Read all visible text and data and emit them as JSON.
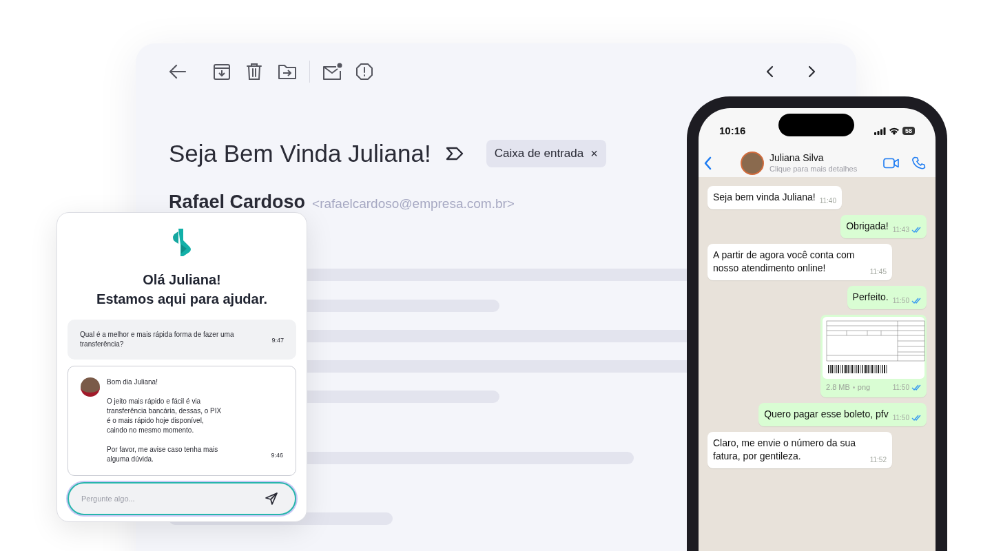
{
  "email": {
    "subject": "Seja Bem Vinda Juliana!",
    "label_chip": {
      "label": "Caixa de entrada",
      "close": "×"
    },
    "sender": {
      "name": "Rafael Cardoso",
      "email": "<rafaelcardoso@empresa.com.br>"
    }
  },
  "chat_widget": {
    "heading": [
      "Olá Juliana!",
      "Estamos aqui para ajudar."
    ],
    "messages": [
      {
        "kind": "user",
        "paragraphs": [
          "Qual é a melhor e mais rápida forma de fazer uma transferência?"
        ],
        "time": "9:47"
      },
      {
        "kind": "agent",
        "paragraphs": [
          "Bom dia Juliana!",
          "O jeito mais rápido e fácil é via transferência bancária, dessas, o PIX é o mais rápido hoje disponível, caindo no mesmo momento.",
          "Por favor, me avise caso tenha mais alguma dúvida."
        ],
        "time": "9:46"
      }
    ],
    "input": {
      "placeholder": "Pergunte algo..."
    }
  },
  "phone": {
    "status_bar": {
      "time": "10:16",
      "battery": "58"
    },
    "contact": {
      "name": "Juliana Silva",
      "subtitle": "Clique para mais detalhes"
    },
    "messages": [
      {
        "outgoing": false,
        "kind": "text",
        "text": "Seja bem vinda Juliana!",
        "time": "11:40"
      },
      {
        "outgoing": true,
        "kind": "text",
        "text": "Obrigada!",
        "time": "11:43",
        "read": true
      },
      {
        "outgoing": false,
        "kind": "text",
        "text": "A partir de agora você conta com nosso atendimento online!",
        "time": "11:45"
      },
      {
        "outgoing": true,
        "kind": "text",
        "text": "Perfeito.",
        "time": "11:50",
        "read": true
      },
      {
        "outgoing": true,
        "kind": "image",
        "size": "2.8 MB",
        "format": "png",
        "time": "11:50",
        "read": true
      },
      {
        "outgoing": true,
        "kind": "text",
        "text": "Quero pagar esse boleto, pfv",
        "time": "11:50",
        "read": true
      },
      {
        "outgoing": false,
        "kind": "text",
        "text": "Claro, me envie o número da sua fatura, por gentileza.",
        "time": "11:52"
      }
    ]
  }
}
